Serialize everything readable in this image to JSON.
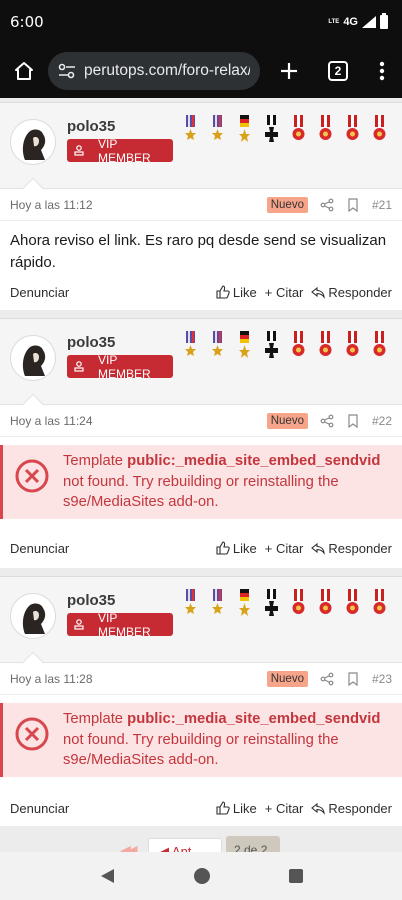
{
  "status_bar": {
    "time": "6:00",
    "network": "4G",
    "network_sub": "LTE"
  },
  "browser": {
    "url": "perutops.com/foro-relax/thr",
    "tab_count": "2"
  },
  "posts": [
    {
      "username": "polo35",
      "badge": "VIP MEMBER",
      "date": "Hoy a las 11:12",
      "new_label": "Nuevo",
      "number": "#21",
      "message": "Ahora reviso el link. Es raro pq desde send se visualizan rápido.",
      "report": "Denunciar",
      "like": "Like",
      "quote": "+ Citar",
      "reply": "Responder"
    },
    {
      "username": "polo35",
      "badge": "VIP MEMBER",
      "date": "Hoy a las 11:24",
      "new_label": "Nuevo",
      "number": "#22",
      "error_prefix": "Template ",
      "error_template": "public:_media_site_embed_sendvid",
      "error_suffix": " not found. Try rebuilding or reinstalling the s9e/MediaSites add-on.",
      "report": "Denunciar",
      "like": "Like",
      "quote": "+ Citar",
      "reply": "Responder"
    },
    {
      "username": "polo35",
      "badge": "VIP MEMBER",
      "date": "Hoy a las 11:28",
      "new_label": "Nuevo",
      "number": "#23",
      "error_prefix": "Template ",
      "error_template": "public:_media_site_embed_sendvid",
      "error_suffix": " not found. Try rebuilding or reinstalling the s9e/MediaSites add-on.",
      "report": "Denunciar",
      "like": "Like",
      "quote": "+ Citar",
      "reply": "Responder"
    }
  ],
  "pagination": {
    "prev": "Ant",
    "current": "2 de 2"
  },
  "medals": [
    "purple-ribbon-medal",
    "purple-ribbon-medal",
    "german-flag-medal",
    "iron-cross-medal",
    "red-cross-medal",
    "red-cross-medal",
    "red-cross-medal",
    "red-cross-medal"
  ],
  "colors": {
    "accent": "#c62b33",
    "new_badge": "#f6a48a",
    "error_bg": "#fde4e4",
    "error_text": "#c3363d"
  }
}
